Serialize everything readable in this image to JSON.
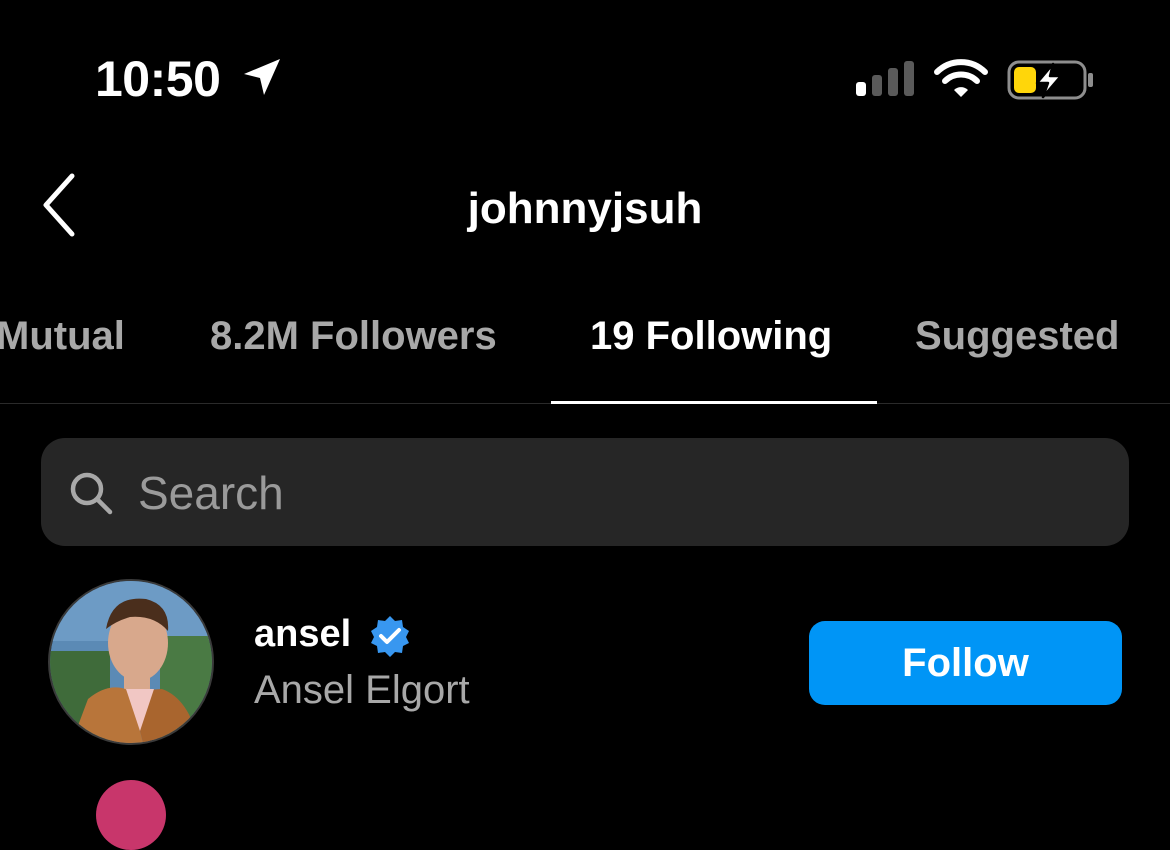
{
  "status_bar": {
    "time": "10:50",
    "icons": [
      "location-arrow-icon",
      "cellular-signal-icon",
      "wifi-icon",
      "battery-charging-icon"
    ],
    "battery_color": "#ffd60a"
  },
  "header": {
    "title": "johnnyjsuh",
    "back_icon": "chevron-left-icon"
  },
  "tabs": [
    {
      "label": "Mutual",
      "active": false
    },
    {
      "label": "8.2M Followers",
      "active": false
    },
    {
      "label": "19 Following",
      "active": true
    },
    {
      "label": "Suggested",
      "active": false
    }
  ],
  "search": {
    "placeholder": "Search",
    "value": "",
    "icon": "search-icon"
  },
  "list": [
    {
      "username": "ansel",
      "verified": true,
      "full_name": "Ansel Elgort",
      "action_label": "Follow"
    }
  ],
  "colors": {
    "background": "#000000",
    "follow_button": "#0095f6",
    "verified_badge": "#3897f0",
    "search_bg": "#262626",
    "secondary_text": "#a8a8a8"
  }
}
